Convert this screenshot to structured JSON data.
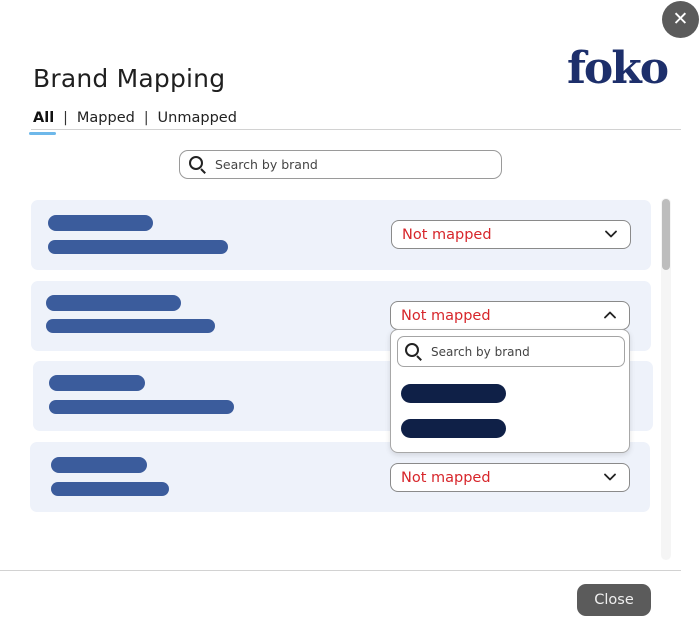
{
  "header": {
    "title": "Brand Mapping",
    "logo_text": "foko"
  },
  "tabs": [
    {
      "label": "All",
      "active": true
    },
    {
      "label": "Mapped",
      "active": false
    },
    {
      "label": "Unmapped",
      "active": false
    }
  ],
  "tab_separator": "|",
  "search": {
    "placeholder": "Search by brand"
  },
  "rows": [
    {
      "status": "Not mapped",
      "dropdown": "collapsed"
    },
    {
      "status": "Not mapped",
      "dropdown": "expanded"
    },
    {
      "status": null,
      "dropdown": "hidden-behind-menu"
    },
    {
      "status": "Not mapped",
      "dropdown": "collapsed"
    }
  ],
  "dropdown_menu": {
    "search_placeholder": "Search by brand",
    "option_count": 2
  },
  "footer": {
    "close_label": "Close"
  },
  "icons": {
    "close": "close-icon",
    "search": "search-icon",
    "chevron_down": "chevron-down-icon",
    "chevron_up": "chevron-up-icon"
  },
  "colors": {
    "accent_underline": "#6eb8ea",
    "status_text": "#d7262b",
    "card_background": "#eef2fa",
    "placeholder_bar": "#3b5c9c",
    "option_bar": "#0f2047",
    "logo": "#1d2f6b",
    "button": "#5b5b5b"
  }
}
